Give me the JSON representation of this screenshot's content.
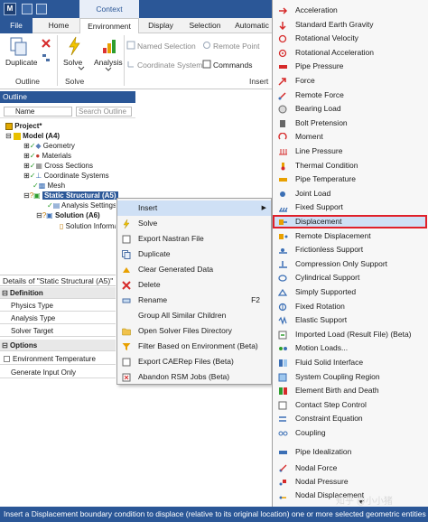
{
  "window": {
    "context_label": "Context",
    "app_icon": "M"
  },
  "tabs": [
    "File",
    "Home",
    "Environment",
    "Display",
    "Selection",
    "Automatic"
  ],
  "ribbon": {
    "duplicate": "Duplicate",
    "solve": "Solve",
    "analysis": "Analysis",
    "named_selection": "Named Selection",
    "remote_point": "Remote Point",
    "coordinate_system": "Coordinate System",
    "commands": "Commands",
    "group_outline": "Outline",
    "group_solve": "Solve",
    "group_insert": "Insert"
  },
  "outline": {
    "title": "Outline",
    "filter_label": "Name",
    "search_placeholder": "Search Outline",
    "tree": {
      "project": "Project*",
      "model": "Model (A4)",
      "geometry": "Geometry",
      "materials": "Materials",
      "cross_sections": "Cross Sections",
      "coordinate_systems": "Coordinate Systems",
      "mesh": "Mesh",
      "static_structural": "Static Structural (A5)",
      "analysis_settings": "Analysis Settings",
      "solution": "Solution (A6)",
      "solution_info": "Solution Information"
    }
  },
  "details": {
    "title": "Details of \"Static Structural (A5)\"",
    "definition": "Definition",
    "physics_type": "Physics Type",
    "analysis_type": "Analysis Type",
    "solver_target": "Solver Target",
    "options": "Options",
    "environment_temperature": "Environment Temperature",
    "generate_input_only": "Generate Input Only"
  },
  "context_menu": [
    {
      "label": "Insert",
      "shortcut": "",
      "icon": "none"
    },
    {
      "label": "Solve",
      "shortcut": "",
      "icon": "lightning-icon"
    },
    {
      "label": "Export Nastran File",
      "shortcut": "",
      "icon": "export-icon"
    },
    {
      "label": "Duplicate",
      "shortcut": "",
      "icon": "duplicate-icon"
    },
    {
      "label": "Clear Generated Data",
      "shortcut": "",
      "icon": "clear-data-icon"
    },
    {
      "label": "Delete",
      "shortcut": "",
      "icon": "delete-icon"
    },
    {
      "label": "Rename",
      "shortcut": "F2",
      "icon": "rename-icon"
    },
    {
      "label": "Group All Similar Children",
      "shortcut": "",
      "icon": "none"
    },
    {
      "label": "Open Solver Files Directory",
      "shortcut": "",
      "icon": "folder-icon"
    },
    {
      "label": "Filter Based on Environment (Beta)",
      "shortcut": "",
      "icon": "filter-icon"
    },
    {
      "label": "Export CAERep Files (Beta)",
      "shortcut": "",
      "icon": "export-icon"
    },
    {
      "label": "Abandon RSM Jobs (Beta)",
      "shortcut": "",
      "icon": "stop-icon"
    }
  ],
  "insert_submenu": [
    "Acceleration",
    "Standard Earth Gravity",
    "Rotational Velocity",
    "Rotational Acceleration",
    "Pipe Pressure",
    "Force",
    "Remote Force",
    "Bearing Load",
    "Bolt Pretension",
    "Moment",
    "Line Pressure",
    "Thermal Condition",
    "Pipe Temperature",
    "Joint Load",
    "Fixed Support",
    "Displacement",
    "Remote Displacement",
    "Frictionless Support",
    "Compression Only Support",
    "Cylindrical Support",
    "Simply Supported",
    "Fixed Rotation",
    "Elastic Support",
    "Imported Load (Result File) (Beta)",
    "Motion Loads...",
    "Fluid Solid Interface",
    "System Coupling Region",
    "Element Birth and Death",
    "Contact Step Control",
    "Constraint Equation",
    "Coupling",
    "Pipe Idealization",
    "Nodal Force",
    "Nodal Pressure",
    "Nodal Displacement"
  ],
  "selected_submenu_item": "Displacement",
  "status": {
    "text": "Insert a Displacement boundary condition to displace (relative to its original location) one or more selected geometric entities",
    "watermark": "知乎 @小小猪"
  },
  "colors": {
    "brand": "#2b5797",
    "highlight": "#cfe0f5",
    "selected_outline": "#e0202a",
    "check": "#2e9e2e"
  }
}
